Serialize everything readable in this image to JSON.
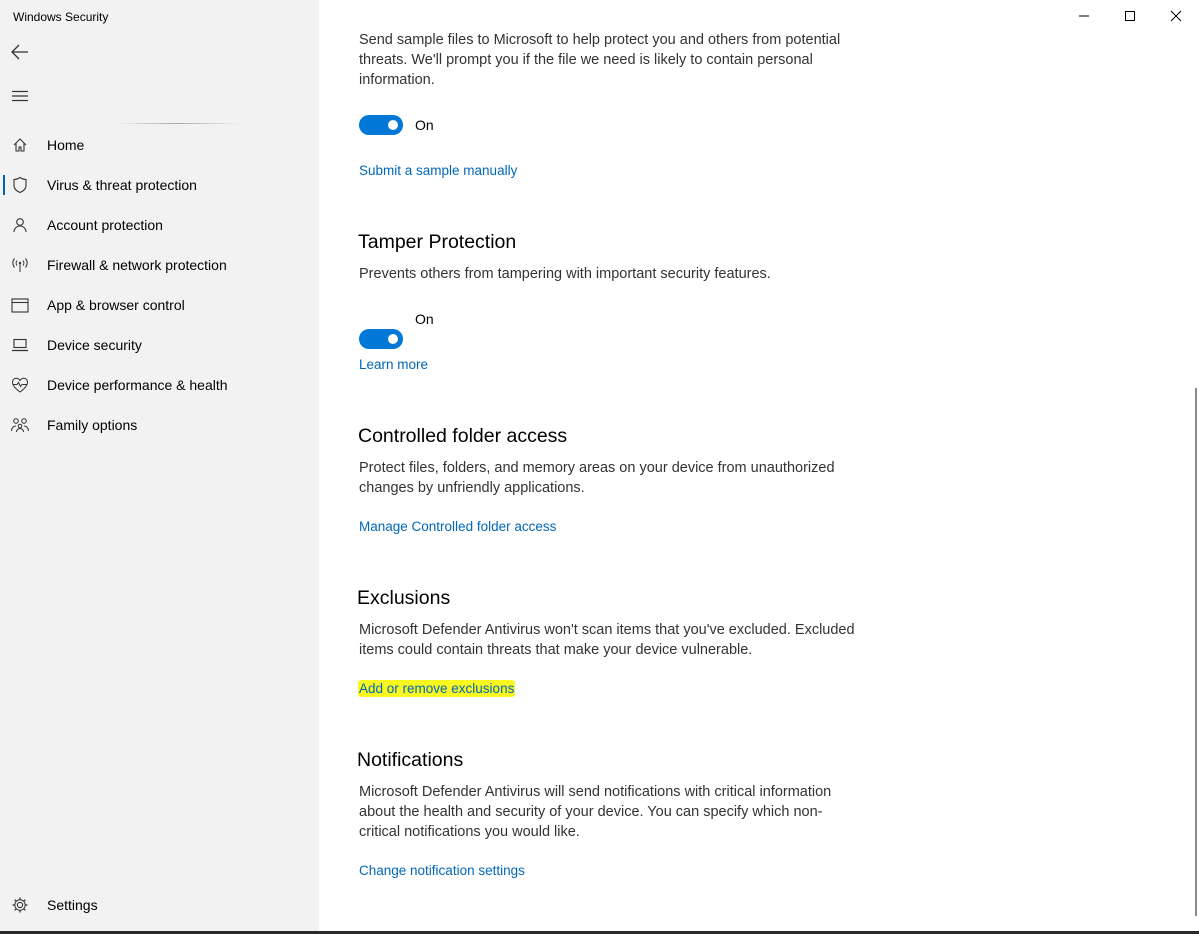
{
  "window": {
    "title": "Windows Security"
  },
  "sidebar": {
    "items": [
      {
        "label": "Home",
        "icon": "home-icon"
      },
      {
        "label": "Virus & threat protection",
        "icon": "shield-icon",
        "selected": true
      },
      {
        "label": "Account protection",
        "icon": "person-icon"
      },
      {
        "label": "Firewall & network protection",
        "icon": "antenna-icon"
      },
      {
        "label": "App & browser control",
        "icon": "browser-window-icon"
      },
      {
        "label": "Device security",
        "icon": "laptop-icon"
      },
      {
        "label": "Device performance & health",
        "icon": "heart-icon"
      },
      {
        "label": "Family options",
        "icon": "family-icon"
      }
    ],
    "settings_label": "Settings"
  },
  "main": {
    "sample_submission": {
      "description": "Send sample files to Microsoft to help protect you and others from potential threats. We'll prompt you if the file we need is likely to contain personal information.",
      "toggle_state": "On",
      "link": "Submit a sample manually"
    },
    "tamper_protection": {
      "heading": "Tamper Protection",
      "description": "Prevents others from tampering with important security features.",
      "toggle_state": "On",
      "link": "Learn more"
    },
    "controlled_folder_access": {
      "heading": "Controlled folder access",
      "description": "Protect files, folders, and memory areas on your device from unauthorized changes by unfriendly applications.",
      "link": "Manage Controlled folder access"
    },
    "exclusions": {
      "heading": "Exclusions",
      "description": "Microsoft Defender Antivirus won't scan items that you've excluded. Excluded items could contain threats that make your device vulnerable.",
      "link": "Add or remove exclusions"
    },
    "notifications": {
      "heading": "Notifications",
      "description": "Microsoft Defender Antivirus will send notifications with critical information about the health and security of your device. You can specify which non-critical notifications you would like.",
      "link": "Change notification settings"
    }
  },
  "colors": {
    "accent": "#0078d7",
    "link": "#0067b8",
    "highlight": "#f8f820",
    "sidebar_bg": "#f2f2f2"
  }
}
